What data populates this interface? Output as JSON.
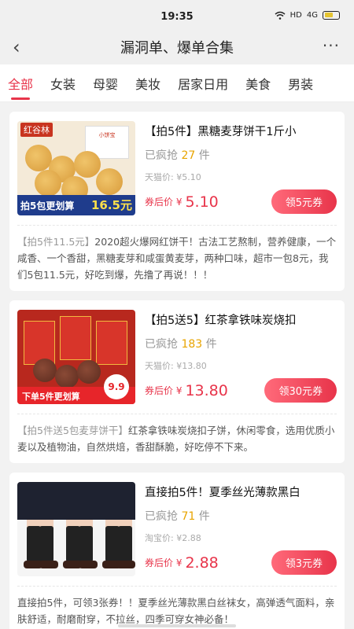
{
  "status_bar": {
    "time": "19:35",
    "network": "HD",
    "signal": "4G"
  },
  "nav": {
    "title": "漏洞单、爆单合集",
    "more": "···"
  },
  "tabs": [
    "全部",
    "女装",
    "母婴",
    "美妆",
    "居家日用",
    "美食",
    "男装"
  ],
  "active_tab": "全部",
  "products": [
    {
      "title": "【拍5件】黑糖麦芽饼干1斤小",
      "sold_prefix": "已疯抢",
      "sold_count": "27",
      "sold_suffix": "件",
      "origin_price": "天猫价: ¥5.10",
      "price_label": "券后价 ¥",
      "price": "5.10",
      "coupon": "领5元券",
      "desc_tag": "【拍5件11.5元】",
      "desc": "2020超火爆网红饼干！古法工艺熬制，营养健康，一个咸香、一个香甜，黑糖麦芽和咸蛋黄麦芽，两种口味，超市一包8元，我们5包11.5元，好吃到爆，先撸了再说！！！",
      "thumb": {
        "brand": "红谷林",
        "package": "小饼宝",
        "banner": "拍5包更划算",
        "banner_price": "16.5元"
      }
    },
    {
      "title": "【拍5送5】红茶拿铁味炭烧扣",
      "sold_prefix": "已疯抢",
      "sold_count": "183",
      "sold_suffix": "件",
      "origin_price": "天猫价: ¥13.80",
      "price_label": "券后价 ¥",
      "price": "13.80",
      "coupon": "领30元券",
      "desc_tag": "【拍5件送5包麦芽饼干】",
      "desc": "红茶拿铁味炭烧扣子饼，休闲零食，选用优质小麦以及植物油，自然烘焙，香甜酥脆，好吃停不下来。",
      "thumb": {
        "banner": "下单5件更划算",
        "badge": "9.9"
      }
    },
    {
      "title": "直接拍5件！夏季丝光薄款黑白",
      "sold_prefix": "已疯抢",
      "sold_count": "71",
      "sold_suffix": "件",
      "origin_price": "淘宝价: ¥2.88",
      "price_label": "券后价 ¥",
      "price": "2.88",
      "coupon": "领3元券",
      "desc_tag": "",
      "desc": "直接拍5件，可领3张券！！夏季丝光薄款黑白丝袜女，高弹透气面料，亲肤舒适，耐磨耐穿，不拉丝，四季可穿女神必备！"
    }
  ],
  "colors": {
    "accent": "#e8344a",
    "sold_number": "#e8a400",
    "background": "#f2f2f2"
  },
  "icons": [
    "back-arrow-icon",
    "more-dots-icon",
    "wifi-icon",
    "battery-icon"
  ]
}
